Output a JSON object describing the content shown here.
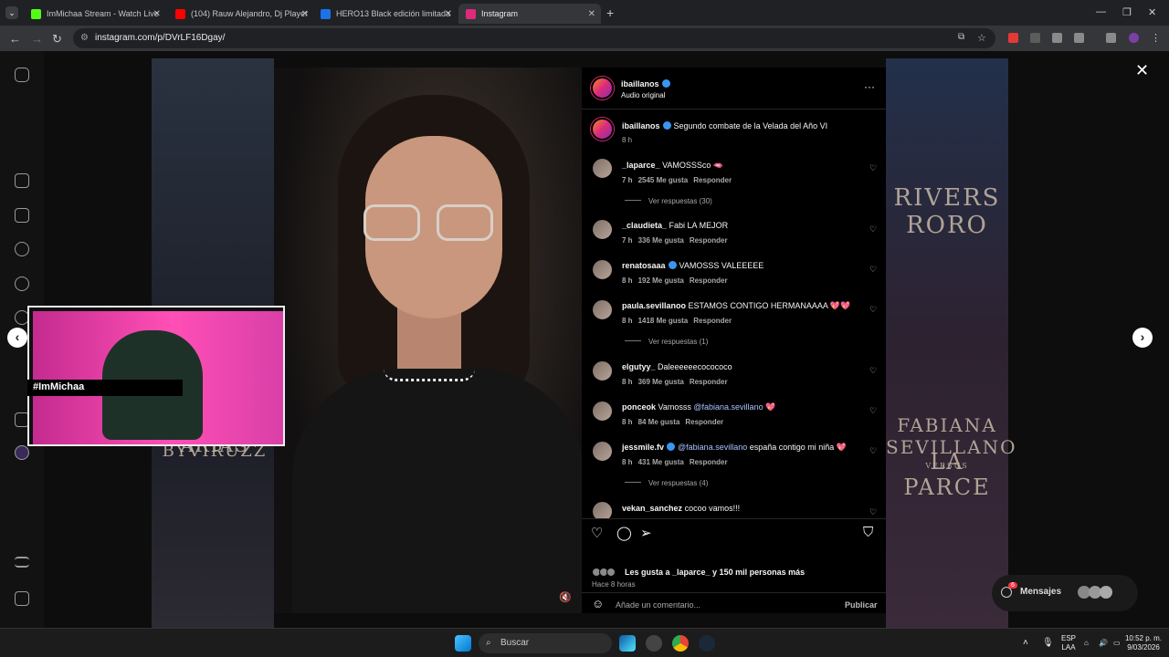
{
  "browser": {
    "tabs": [
      {
        "title": "ImMichaa Stream - Watch Live",
        "color": "#53fc18"
      },
      {
        "title": "(104) Rauw Alejandro, Dj Player",
        "color": "#ff0000"
      },
      {
        "title": "HERO13 Black edición limitada",
        "color": "#1a73e8"
      },
      {
        "title": "Instagram",
        "color": "#dd2a7b"
      }
    ],
    "url": "instagram.com/p/DVrLF16Dgay/"
  },
  "background": {
    "poster_top_right_title": "RIVERS",
    "poster_top_right_sub": "RORO",
    "poster_left_title": "GERO ARIAS",
    "poster_left_sub": "BYVIRUZZ",
    "poster_right_title": "FABIANA SEVILLANO",
    "poster_right_vs": "VERSUS",
    "poster_right_sub": "LA PARCE"
  },
  "webcam": {
    "tag": "#ImMichaa"
  },
  "post": {
    "author": "ibaillanos",
    "audio": "Audio original",
    "caption": "Segundo combate de la Velada del Año VI",
    "caption_time": "8 h",
    "likes_text": "Les gusta a _laparce_ y 150 mil personas más",
    "posted": "Hace 8 horas",
    "comment_placeholder": "Añade un comentario...",
    "publish": "Publicar"
  },
  "comments": [
    {
      "user": "_laparce_",
      "text": "VAMOSSSco 🫦",
      "time": "7 h",
      "likes": "2545 Me gusta",
      "reply": "Responder",
      "replies": "Ver respuestas (30)"
    },
    {
      "user": "_claudieta_",
      "text": "Fabi LA MEJOR",
      "time": "7 h",
      "likes": "336 Me gusta",
      "reply": "Responder"
    },
    {
      "user": "renatosaaa",
      "text": "VAMOSSS VALEEEEE",
      "time": "8 h",
      "likes": "192 Me gusta",
      "reply": "Responder"
    },
    {
      "user": "paula.sevillanoo",
      "text": "ESTAMOS CONTIGO HERMANAAAA 💖💖",
      "time": "8 h",
      "likes": "1418 Me gusta",
      "reply": "Responder",
      "replies": "Ver respuestas (1)"
    },
    {
      "user": "elgutyy_",
      "text": "Daleeeeeecocococo",
      "time": "8 h",
      "likes": "369 Me gusta",
      "reply": "Responder"
    },
    {
      "user": "ponceok",
      "text": "Vamosss",
      "mention": "@fabiana.sevillano",
      "tail": "💖",
      "time": "8 h",
      "likes": "84 Me gusta",
      "reply": "Responder"
    },
    {
      "user": "jessmile.fv",
      "mention": "@fabiana.sevillano",
      "text": "españa contigo mi niña 💖",
      "time": "8 h",
      "likes": "431 Me gusta",
      "reply": "Responder",
      "replies": "Ver respuestas (4)"
    },
    {
      "user": "vekan_sanchez",
      "text": "cocoo vamos!!!"
    }
  ],
  "dock": {
    "label": "Mensajes",
    "badge": "6"
  },
  "taskbar": {
    "search": "Buscar",
    "lang1": "ESP",
    "lang2": "LAA",
    "time": "10:52 p. m.",
    "date": "9/03/2026"
  }
}
